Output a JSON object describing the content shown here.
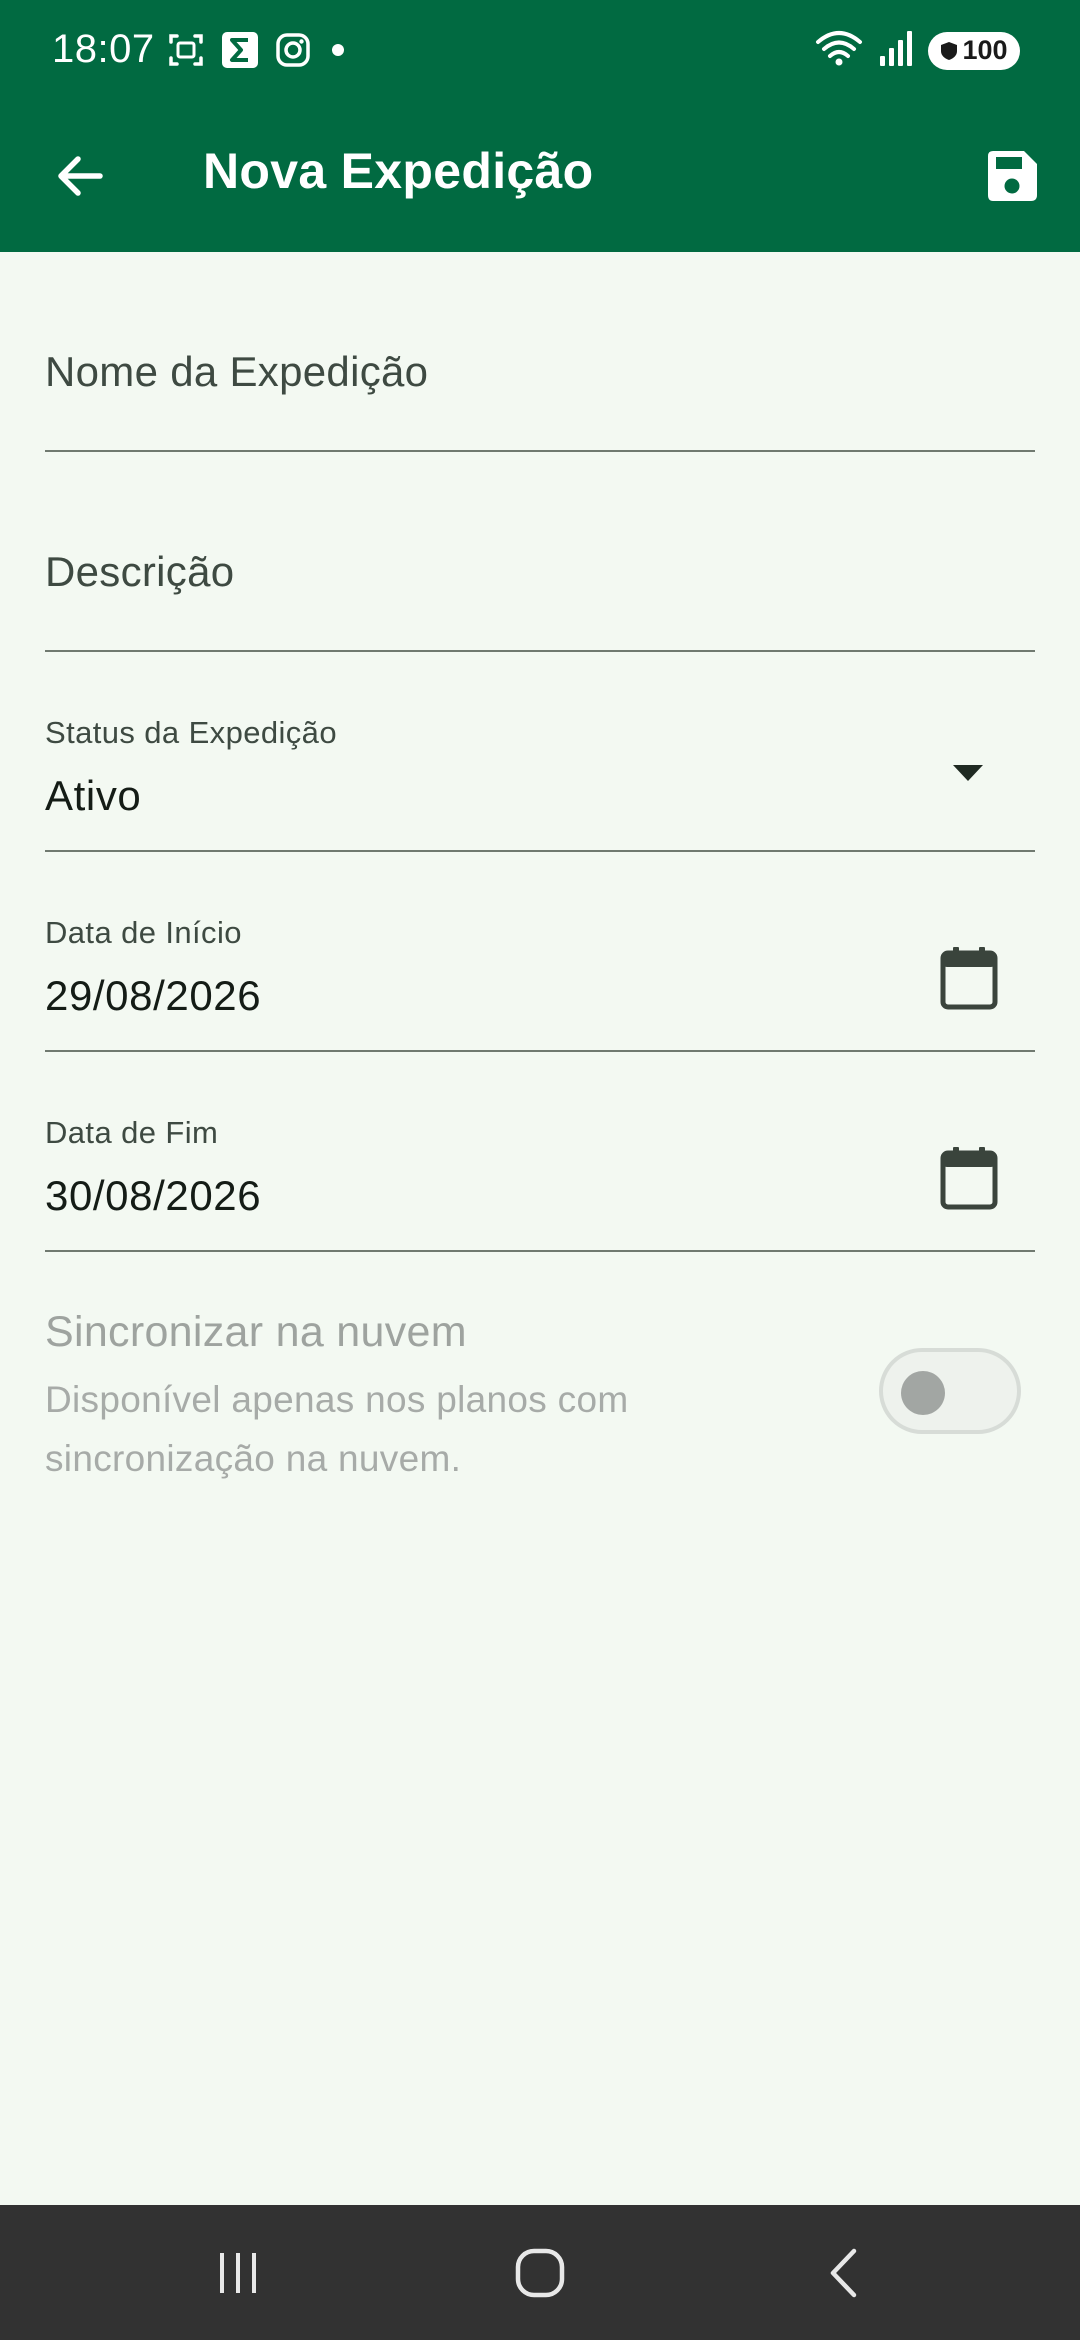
{
  "status_bar": {
    "time": "18:07",
    "battery": "100",
    "left_icons": [
      "screenshot-icon",
      "sigma-app-icon",
      "instagram-icon",
      "dot-icon"
    ],
    "right_icons": [
      "wifi-icon",
      "signal-icon",
      "battery-icon"
    ]
  },
  "app_bar": {
    "title": "Nova Expedição",
    "back_icon": "arrow-left-icon",
    "save_icon": "save-icon"
  },
  "form": {
    "name_placeholder": "Nome da Expedição",
    "description_placeholder": "Descrição",
    "status": {
      "label": "Status da Expedição",
      "value": "Ativo"
    },
    "start_date": {
      "label": "Data de Início",
      "value": "29/08/2026"
    },
    "end_date": {
      "label": "Data de Fim",
      "value": "30/08/2026"
    }
  },
  "sync": {
    "title": "Sincronizar na nuvem",
    "description": "Disponível apenas nos planos com sincronização na nuvem.",
    "enabled": false
  },
  "colors": {
    "primary": "#016a41",
    "background": "#f3f9f2",
    "nav_bar": "#323232"
  }
}
